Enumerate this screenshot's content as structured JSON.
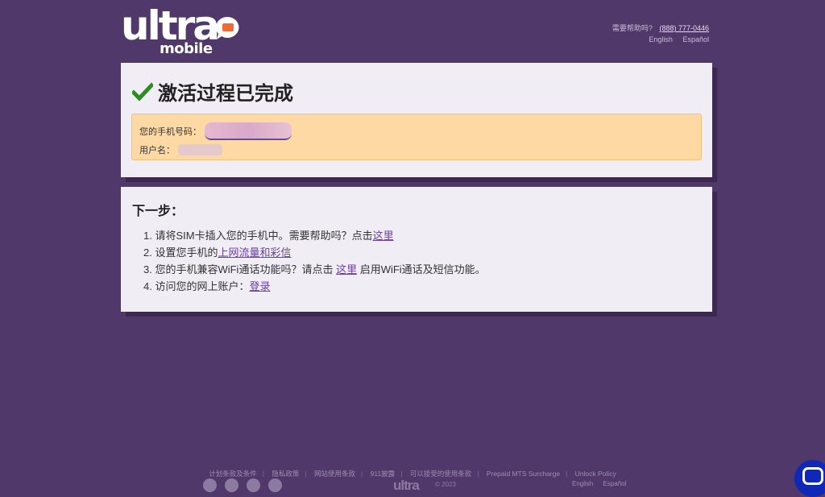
{
  "brand": {
    "logo_word": "ultra",
    "logo_sub": "mobile",
    "accent": "#ed6b34"
  },
  "header": {
    "help_text": "需要帮助吗?",
    "phone": "(888) 777-0446",
    "languages": [
      "English",
      "Español"
    ]
  },
  "activation": {
    "title": "激活过程已完成",
    "phone_label": "您的手机号码：",
    "username_label": "用户名："
  },
  "next_steps": {
    "heading": "下一步：",
    "items": [
      {
        "text": "1. 请将SIM卡插入您的手机中。需要帮助吗？点击",
        "link": "这里",
        "after": ""
      },
      {
        "text": "2. 设置您手机的",
        "link": "上网流量和彩信",
        "after": ""
      },
      {
        "text": "3. 您的手机兼容WiFi通话功能吗？请点击 ",
        "link": "这里",
        "after": " 启用WiFi通话及短信功能。"
      },
      {
        "text": "4. 访问您的网上账户：",
        "link": "登录",
        "after": ""
      }
    ]
  },
  "footer": {
    "links": [
      "计划条款及条件",
      "隐私政策",
      "网站使用条款",
      "911披露",
      "可以接受的使用条款",
      "Prepaid MTS Surcharge",
      "Unlock Policy"
    ],
    "logo": "ultra",
    "copyright": "© 2023",
    "languages": [
      "English",
      "Español"
    ]
  },
  "colors": {
    "background": "#51386a",
    "card": "#f0edf5",
    "notice": "#fed9a4",
    "link": "#6a3fa0",
    "check": "#2e8b22"
  }
}
